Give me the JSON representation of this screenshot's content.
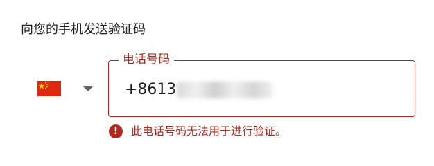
{
  "heading": "向您的手机发送验证码",
  "country_picker": {
    "flag_icon": "china-flag-icon",
    "arrow_icon": "dropdown-arrow-icon"
  },
  "phone_field": {
    "label": "电话号码",
    "value": "+8613"
  },
  "error": {
    "icon": "error-icon",
    "icon_glyph": "!",
    "message": "此电话号码无法用于进行验证。"
  },
  "colors": {
    "error": "#b3261e",
    "text": "#202124",
    "flag_red": "#de2910",
    "flag_yellow": "#ffde00"
  }
}
